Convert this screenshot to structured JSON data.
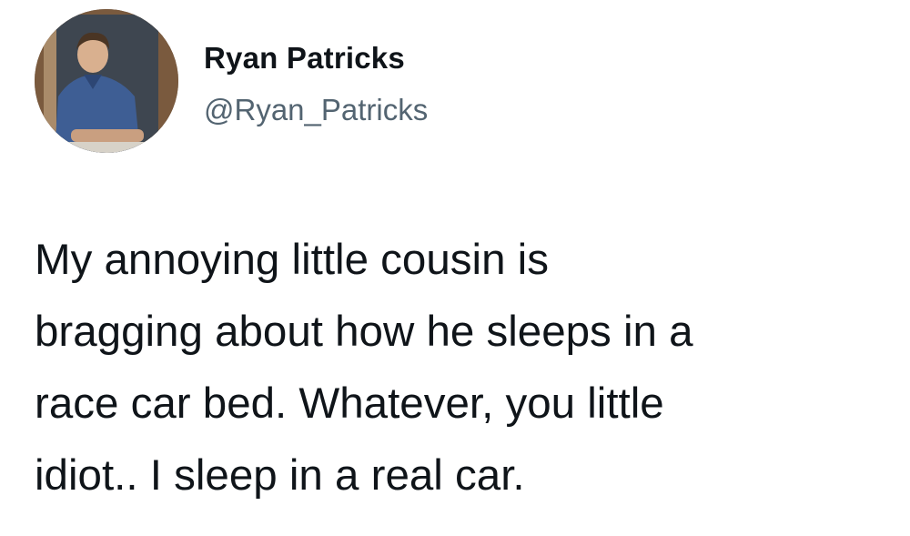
{
  "tweet": {
    "author": {
      "display_name": "Ryan Patricks",
      "handle": "@Ryan_Patricks",
      "avatar": "school-portrait-photo"
    },
    "text_lines": [
      "My annoying little cousin is",
      "bragging about how he sleeps in a",
      "race car bed. Whatever, you little",
      "idiot.. I sleep in a real car."
    ]
  }
}
